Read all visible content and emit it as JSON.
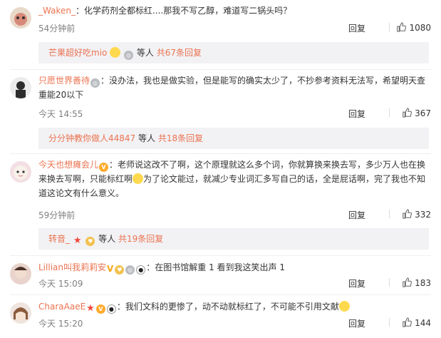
{
  "comments": [
    {
      "user": "_Waken_",
      "text": "化学药剂全都标红....那我不写乙醇，难道写二锅头吗？",
      "time": "54分钟前",
      "reply": "回复",
      "likes": "1080",
      "sub": {
        "user": "芒果超好吃mio",
        "tail": "等人",
        "count_text": "共67条回复"
      }
    },
    {
      "user": "只愿世界善待",
      "text": "没办法，我也是做实验，但是能写的确实太少了，不抄参考资料无法写，希望明天查重能20以下",
      "time": "今天 14:55",
      "reply": "回复",
      "likes": "367",
      "sub": {
        "user": "分分钟教你做人44847",
        "tail": "等人",
        "count_text": "共18条回复"
      }
    },
    {
      "user": "今天也想瘫会儿",
      "text_a": "老师说这改不了啊，这个原理就这么多个词，你就算换来换去写，多少万人也在换来换去写啊，只能标红啊",
      "text_b": "为了论文能过，就减少专业词汇多写自己的话，全是屁话啊，完了我也不知道这论文有什么意义。",
      "time": "59分钟前",
      "reply": "回复",
      "likes": "332",
      "sub": {
        "user": "转音_",
        "tail": "等人",
        "count_text": "共19条回复"
      }
    },
    {
      "user": "Lillian叫我莉莉安",
      "text": "在图书馆解重   1   看到我这笑出声   1",
      "time": "今天 15:09",
      "reply": "回复",
      "likes": "183"
    },
    {
      "user": "CharaAaeE",
      "text": "我们文科的更惨了，动不动就标红了，不可能不引用文献",
      "time": "今天 15:20",
      "reply": "回复",
      "likes": "144"
    }
  ],
  "colors": {
    "username": "#eb7350",
    "subbox_bg": "#f2f2f5",
    "meta": "#808080"
  }
}
